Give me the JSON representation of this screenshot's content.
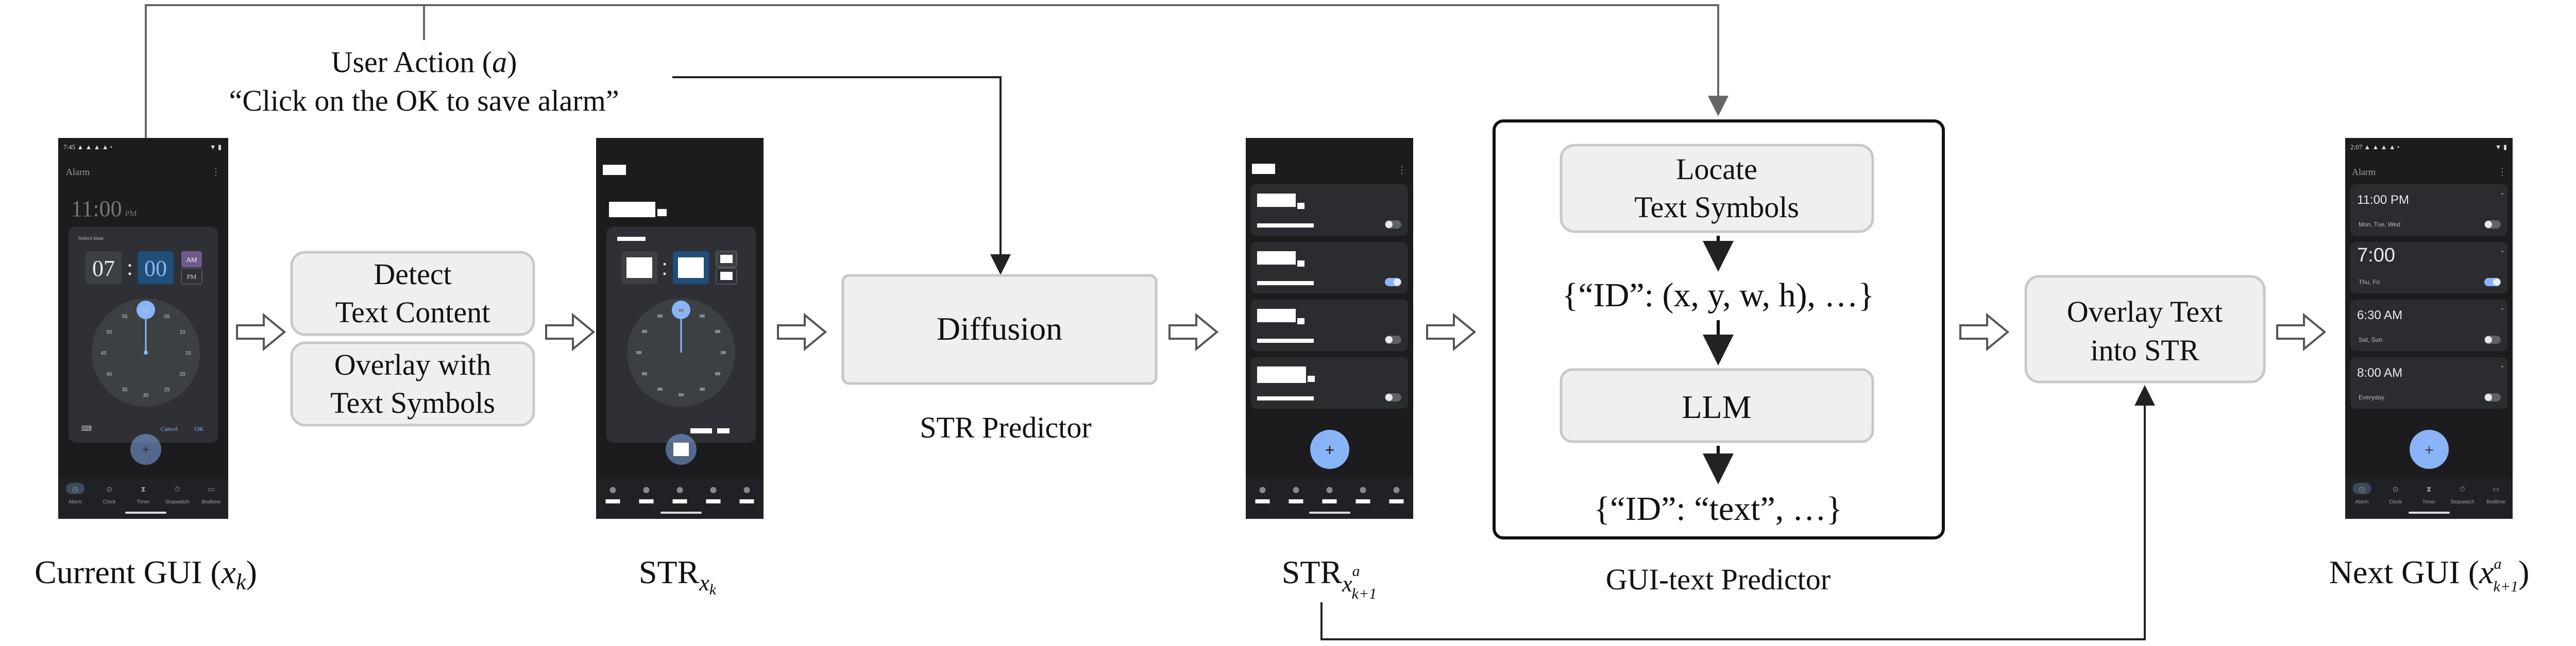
{
  "user_action": {
    "title": "User Action",
    "var": "a",
    "quote": "“Click on the OK to save alarm”"
  },
  "preprocess": {
    "detect_line1": "Detect",
    "detect_line2": "Text Content",
    "overlay_line1": "Overlay with",
    "overlay_line2": "Text Symbols"
  },
  "diffusion": {
    "label": "Diffusion",
    "caption": "STR Predictor"
  },
  "gui_text": {
    "locate_line1": "Locate",
    "locate_line2": "Text Symbols",
    "bbox_json": "{“ID”: (x, y, w, h), …}",
    "llm": "LLM",
    "text_json": "{“ID”: “text”, …}",
    "caption": "GUI-text Predictor"
  },
  "overlay_text": {
    "line1": "Overlay Text",
    "line2": "into STR"
  },
  "captions": {
    "current_gui_prefix": "Current GUI (",
    "current_gui_var": "x",
    "current_gui_sub": "k",
    "current_gui_suffix": ")",
    "str_k": "STR",
    "str_k_sub_var": "x",
    "str_k_sub_sub": "k",
    "str_k1": "STR",
    "str_k1_var": "x",
    "str_k1_sup": "a",
    "str_k1_sub": "k+1",
    "next_gui_prefix": "Next GUI (",
    "next_gui_var": "x",
    "next_gui_sup": "a",
    "next_gui_sub": "k+1",
    "next_gui_suffix": ")"
  },
  "phone_current": {
    "status": "7:45 ▲ ▲ ▲ ▲ •",
    "status_right": "▼ ▮",
    "app_title": "Alarm",
    "big_time": "11:00",
    "big_time_suffix": "PM",
    "dialog_title": "Select time",
    "hour": "07",
    "colon": ":",
    "minute": "00",
    "am": "AM",
    "pm": "PM",
    "clock_numbers": [
      "00",
      "05",
      "10",
      "15",
      "20",
      "25",
      "30",
      "35",
      "40",
      "45",
      "50",
      "55"
    ],
    "cancel": "Cancel",
    "ok": "OK",
    "fab": "+",
    "nav": [
      "Alarm",
      "Clock",
      "Timer",
      "Stopwatch",
      "Bedtime"
    ]
  },
  "phone_next": {
    "status": "2:07 ▲ ▲ ▲ ▲ •",
    "status_right": "▼ ▮",
    "app_title": "Alarm",
    "alarms": [
      {
        "time": "11:00 PM",
        "days": "Mon, Tue, Wed",
        "on": false
      },
      {
        "time": "7:00",
        "days": "Thu, Fri",
        "on": true
      },
      {
        "time": "6:30 AM",
        "days": "Sat, Sun",
        "on": false
      },
      {
        "time": "8:00 AM",
        "days": "Everyday",
        "on": false
      }
    ],
    "fab": "+",
    "nav": [
      "Alarm",
      "Clock",
      "Timer",
      "Stopwatch",
      "Bedtime"
    ]
  },
  "colors": {
    "box_fill": "#efefef",
    "box_stroke": "#c8c8c8",
    "phone_bg": "#1c1c1e",
    "phone_dialog": "#2e3036",
    "accent_blue": "#8ab4f8",
    "arrow": "#444444"
  }
}
